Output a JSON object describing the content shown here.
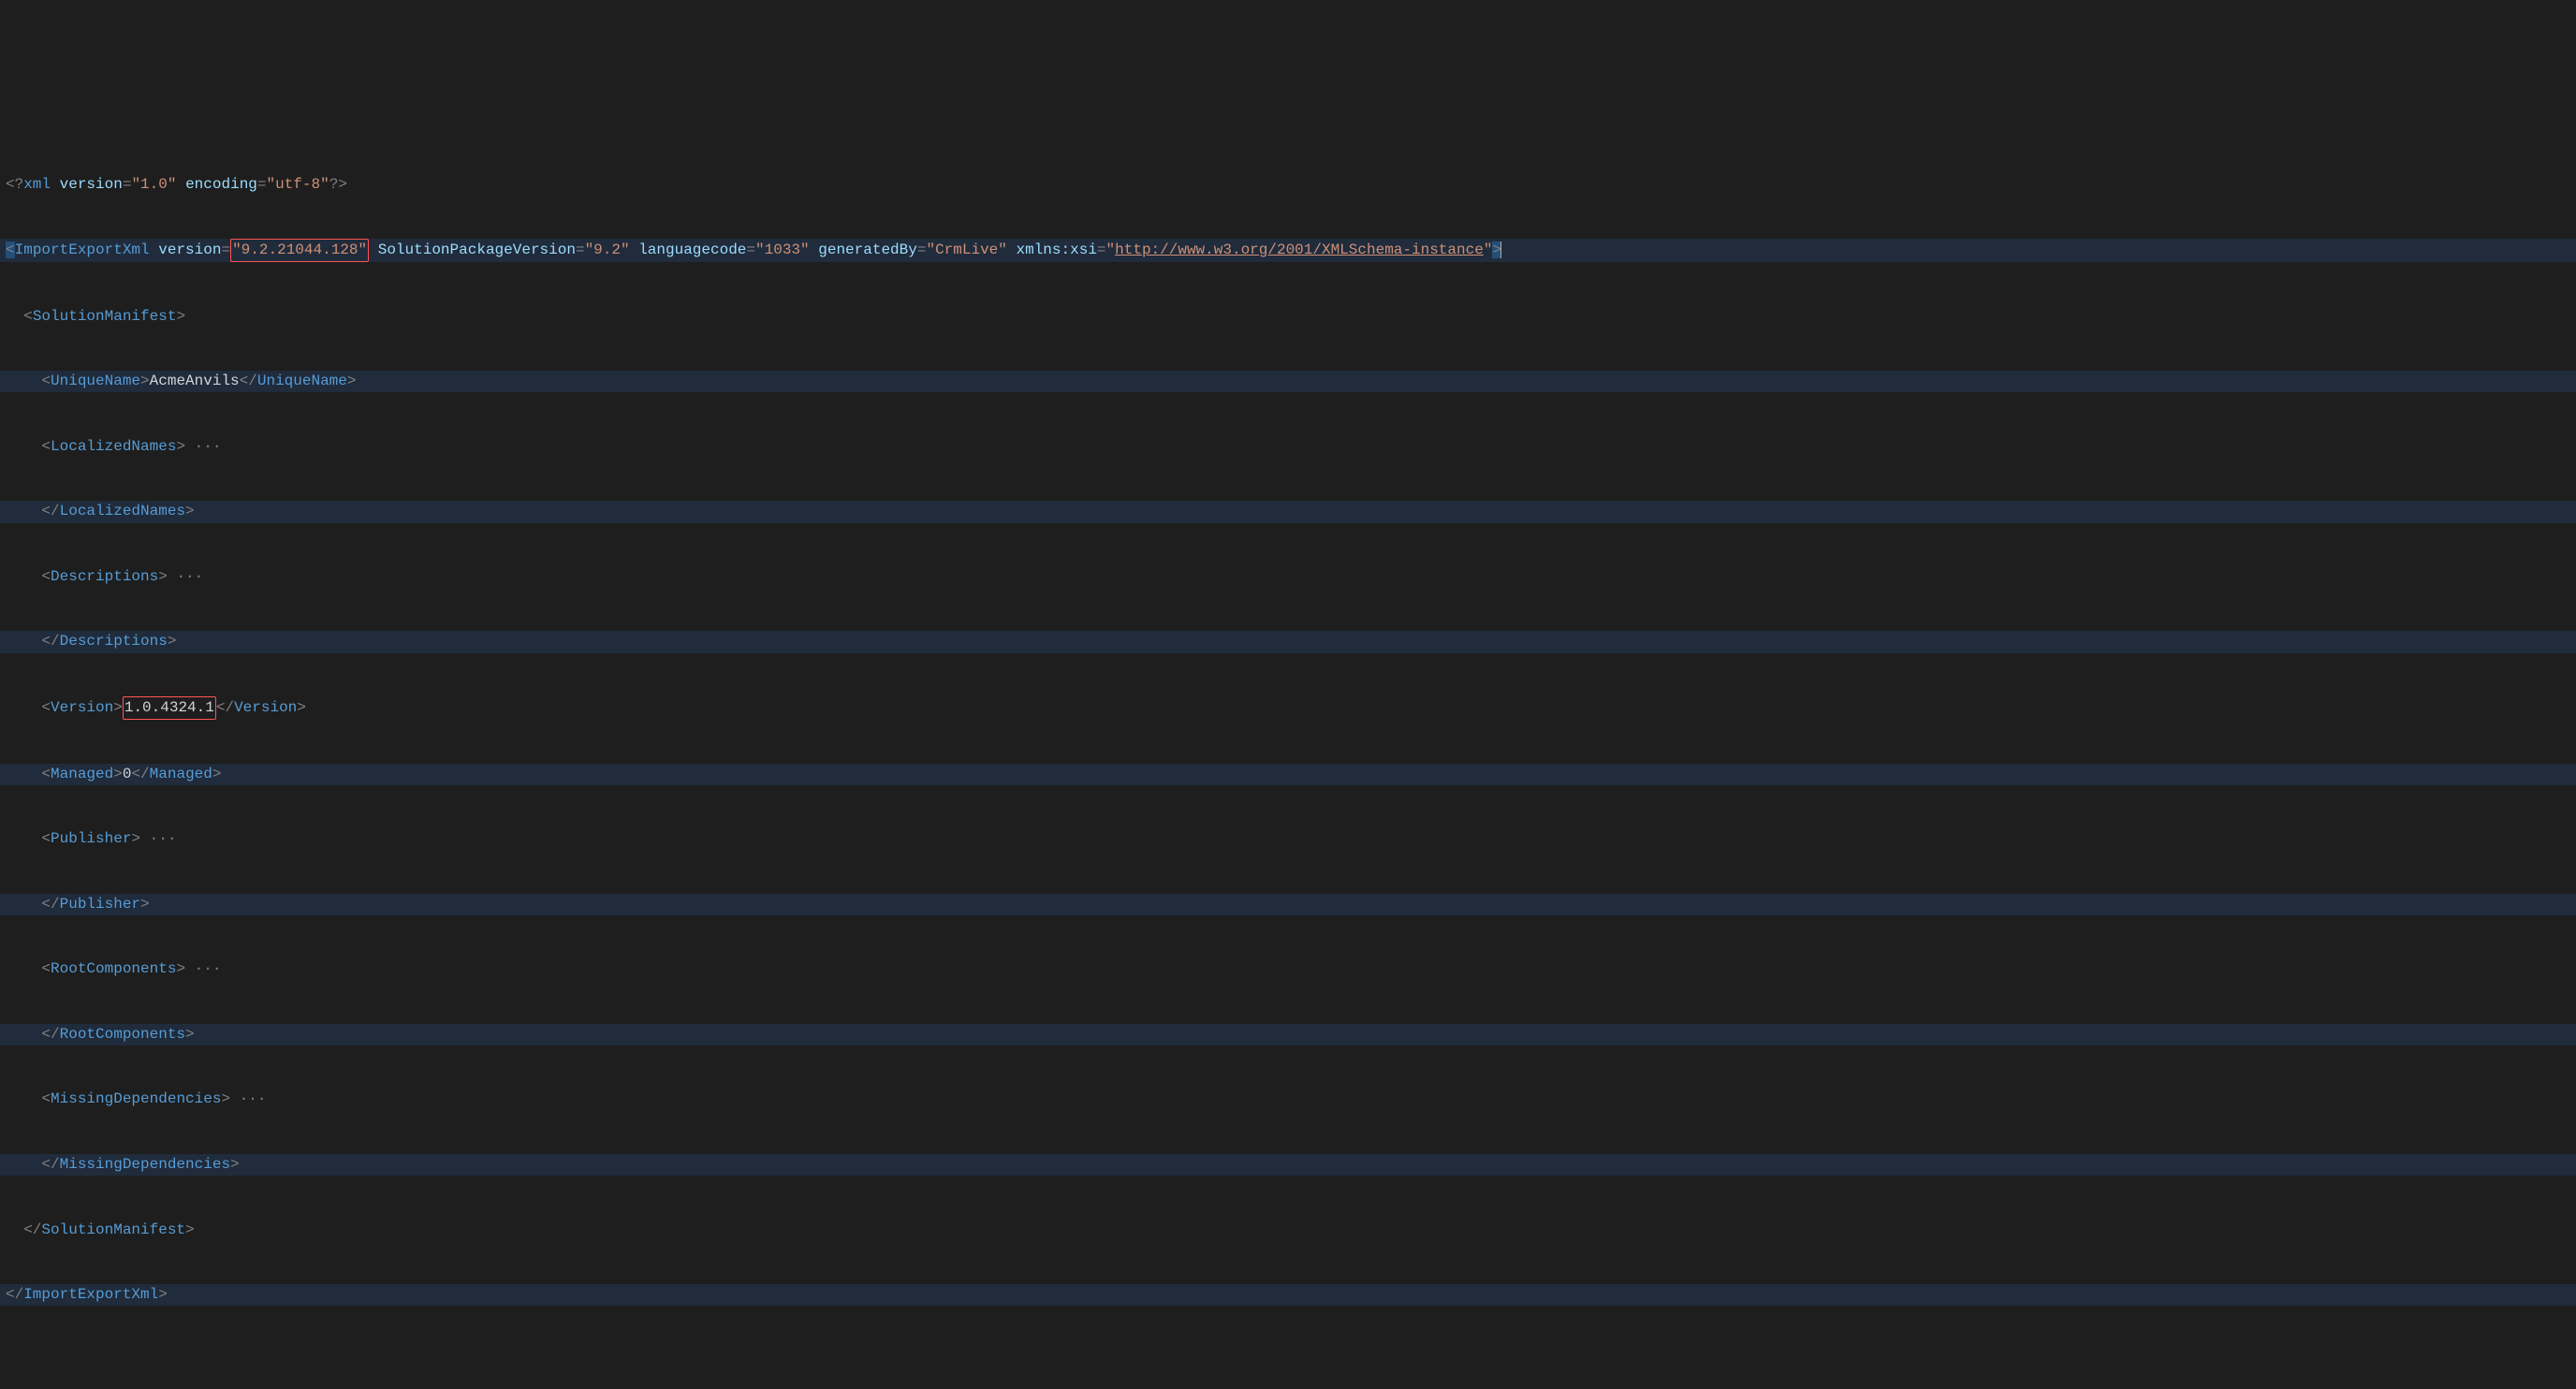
{
  "xmlDecl": {
    "piOpen": "<?",
    "name": "xml",
    "attrs": [
      {
        "name": "version",
        "value": "\"1.0\""
      },
      {
        "name": "encoding",
        "value": "\"utf-8\""
      }
    ],
    "piClose": "?>"
  },
  "root": {
    "name": "ImportExportXml",
    "attrs": [
      {
        "name": "version",
        "value": "\"9.2.21044.128\"",
        "highlighted": true
      },
      {
        "name": "SolutionPackageVersion",
        "value": "\"9.2\""
      },
      {
        "name": "languagecode",
        "value": "\"1033\""
      },
      {
        "name": "generatedBy",
        "value": "\"CrmLive\""
      },
      {
        "name": "xmlns:xsi",
        "value": "\"http://www.w3.org/2001/XMLSchema-instance\"",
        "isUrl": true
      }
    ],
    "closeChar": ">"
  },
  "manifest": {
    "open": "SolutionManifest",
    "close": "SolutionManifest"
  },
  "uniqueName": {
    "open": "UniqueName",
    "value": "AcmeAnvils",
    "close": "UniqueName"
  },
  "localizedNames": {
    "open": "LocalizedNames",
    "close": "LocalizedNames"
  },
  "descriptions": {
    "open": "Descriptions",
    "close": "Descriptions"
  },
  "version": {
    "open": "Version",
    "value": "1.0.4324.1",
    "close": "Version",
    "highlighted": true
  },
  "managed": {
    "open": "Managed",
    "value": "0",
    "close": "Managed"
  },
  "publisher": {
    "open": "Publisher",
    "close": "Publisher"
  },
  "rootComponents": {
    "open": "RootComponents",
    "close": "RootComponents"
  },
  "missingDependencies": {
    "open": "MissingDependencies",
    "close": "MissingDependencies"
  },
  "rootClose": "ImportExportXml",
  "foldMarker": "···",
  "indent": {
    "l0": "",
    "l1": "  ",
    "l2": "    ",
    "l3": "      "
  },
  "symbols": {
    "lt": "<",
    "gt": ">",
    "ltSlash": "</",
    "eq": "="
  }
}
